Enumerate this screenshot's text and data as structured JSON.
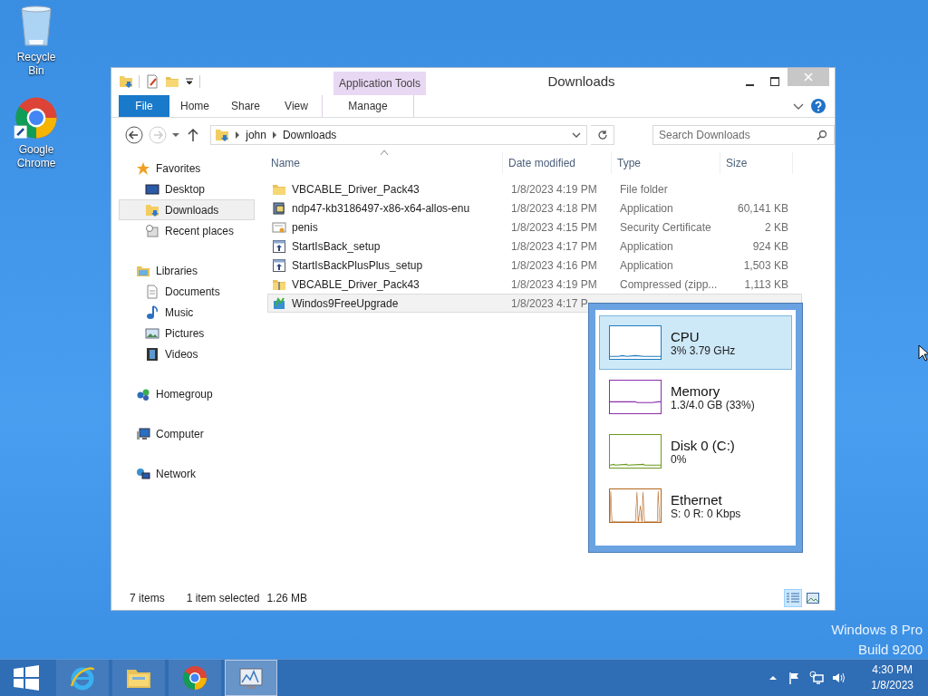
{
  "desktop_icons": [
    {
      "label": "Recycle Bin",
      "kind": "recycle"
    },
    {
      "label": "Google Chrome",
      "kind": "chrome"
    }
  ],
  "window": {
    "title": "Downloads",
    "context_tab": {
      "header": "Application Tools",
      "label": "Manage"
    },
    "ribbon_tabs": [
      {
        "label": "File",
        "kind": "file"
      },
      {
        "label": "Home",
        "kind": "tab"
      },
      {
        "label": "Share",
        "kind": "tab"
      },
      {
        "label": "View",
        "kind": "tab"
      }
    ],
    "address": {
      "crumbs": [
        "john",
        "Downloads"
      ]
    },
    "search": {
      "placeholder": "Search Downloads"
    },
    "nav": [
      {
        "label": "Favorites",
        "kind": "star",
        "selected": false,
        "children": [
          {
            "label": "Desktop",
            "kind": "desktop",
            "selected": false
          },
          {
            "label": "Downloads",
            "kind": "downloads",
            "selected": true
          },
          {
            "label": "Recent places",
            "kind": "recent",
            "selected": false
          }
        ]
      },
      {
        "label": "Libraries",
        "kind": "libraries",
        "selected": false,
        "children": [
          {
            "label": "Documents",
            "kind": "documents",
            "selected": false
          },
          {
            "label": "Music",
            "kind": "music",
            "selected": false
          },
          {
            "label": "Pictures",
            "kind": "pictures",
            "selected": false
          },
          {
            "label": "Videos",
            "kind": "videos",
            "selected": false
          }
        ]
      },
      {
        "label": "Homegroup",
        "kind": "homegroup",
        "selected": false
      },
      {
        "label": "Computer",
        "kind": "computer",
        "selected": false
      },
      {
        "label": "Network",
        "kind": "network",
        "selected": false
      }
    ],
    "columns": [
      {
        "label": "Name",
        "sorted": true
      },
      {
        "label": "Date modified",
        "sorted": false
      },
      {
        "label": "Type",
        "sorted": false
      },
      {
        "label": "Size",
        "sorted": false
      }
    ],
    "rows": [
      {
        "name": "VBCABLE_Driver_Pack43",
        "date": "1/8/2023 4:19 PM",
        "type": "File folder",
        "kind": "folder",
        "selected": false
      },
      {
        "name": "ndp47-kb3186497-x86-x64-allos-enu",
        "date": "1/8/2023 4:18 PM",
        "type": "Application",
        "size": "60,141 KB",
        "kind": "installer",
        "selected": false
      },
      {
        "name": "penis",
        "date": "1/8/2023 4:15 PM",
        "type": "Security Certificate",
        "size": "2 KB",
        "kind": "certificate",
        "selected": false
      },
      {
        "name": "StartIsBack_setup",
        "date": "1/8/2023 4:17 PM",
        "type": "Application",
        "size": "924 KB",
        "kind": "setup",
        "selected": false
      },
      {
        "name": "StartIsBackPlusPlus_setup",
        "date": "1/8/2023 4:16 PM",
        "type": "Application",
        "size": "1,503 KB",
        "kind": "setup",
        "selected": false
      },
      {
        "name": "VBCABLE_Driver_Pack43",
        "date": "1/8/2023 4:19 PM",
        "type": "Compressed (zipp...",
        "size": "1,113 KB",
        "kind": "zip",
        "selected": false
      },
      {
        "name": "Windos9FreeUpgrade",
        "date": "1/8/2023 4:17 P",
        "kind": "upgrade",
        "selected": true
      }
    ],
    "status": {
      "count": "7 items",
      "selection": "1 item selected",
      "size": "1.26 MB"
    },
    "views": [
      {
        "kind": "details",
        "selected": true
      },
      {
        "kind": "icons",
        "selected": false
      }
    ]
  },
  "performance": {
    "items": [
      {
        "name": "CPU",
        "reading": "3%  3.79 GHz",
        "kind": "cpu",
        "color": "#1c7dc0",
        "selected": true
      },
      {
        "name": "Memory",
        "reading": "1.3/4.0 GB (33%)",
        "kind": "memory",
        "color": "#8b2fa8",
        "selected": false
      },
      {
        "name": "Disk 0 (C:)",
        "reading": "0%",
        "kind": "disk",
        "color": "#6b9a1f",
        "selected": false
      },
      {
        "name": "Ethernet",
        "reading": "S: 0 R: 0 Kbps",
        "kind": "ethernet",
        "color": "#b5651d",
        "selected": false
      }
    ]
  },
  "edition": [
    "Windows 8 Pro",
    "Build 9200"
  ],
  "taskbar": {
    "items": [
      {
        "kind": "start",
        "selected": false
      },
      {
        "kind": "ie",
        "selected": false
      },
      {
        "kind": "explorer",
        "selected": false
      },
      {
        "kind": "chrome",
        "selected": false
      },
      {
        "kind": "taskmgr",
        "selected": true
      }
    ],
    "tray": [
      {
        "kind": "arrow"
      },
      {
        "kind": "flag"
      },
      {
        "kind": "network"
      },
      {
        "kind": "volume"
      }
    ],
    "clock": {
      "time": "4:30 PM",
      "date": "1/8/2023"
    }
  }
}
